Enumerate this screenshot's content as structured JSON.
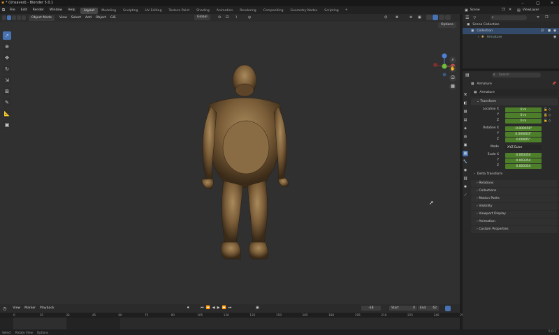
{
  "window": {
    "title": "* (Unsaved) - Blender 5.0.1"
  },
  "menu": [
    "File",
    "Edit",
    "Render",
    "Window",
    "Help"
  ],
  "workspaces": [
    {
      "label": "Layout",
      "active": true
    },
    {
      "label": "Modeling",
      "active": false
    },
    {
      "label": "Sculpting",
      "active": false
    },
    {
      "label": "UV Editing",
      "active": false
    },
    {
      "label": "Texture Paint",
      "active": false
    },
    {
      "label": "Shading",
      "active": false
    },
    {
      "label": "Animation",
      "active": false
    },
    {
      "label": "Rendering",
      "active": false
    },
    {
      "label": "Compositing",
      "active": false
    },
    {
      "label": "Geometry Nodes",
      "active": false
    },
    {
      "label": "Scripting",
      "active": false
    }
  ],
  "add_workspace": "+",
  "scene": "Scene",
  "view_layer": "ViewLayer",
  "viewport_header": {
    "mode": "Object Mode",
    "menus": [
      "View",
      "Select",
      "Add",
      "Object",
      "GIS"
    ],
    "orientation": "Global",
    "options": "Options"
  },
  "outliner": {
    "search_placeholder": "",
    "root": "Scene Collection",
    "collection": "Collection",
    "child": "Armature"
  },
  "properties": {
    "search_placeholder": "Search",
    "object_name": "Armature",
    "data_name": "Armature",
    "transform_title": "Transform",
    "location_label": "Location X",
    "location": [
      "0 m",
      "0 m",
      "0 m"
    ],
    "rotation_label": "Rotation X",
    "rotation": [
      "-0.000058°",
      "0.000003°",
      "0.00005°"
    ],
    "mode_label": "Mode",
    "mode_value": "XYZ Euler",
    "scale_label": "Scale X",
    "scale": [
      "0.003354",
      "0.003354",
      "0.003354"
    ],
    "axis_y": "Y",
    "axis_z": "Z",
    "delta": "Delta Transform",
    "panels": [
      "Relations",
      "Collections",
      "Motion Paths",
      "Visibility",
      "Viewport Display",
      "Animation",
      "Custom Properties"
    ]
  },
  "timeline": {
    "menus": [
      "View",
      "Marker",
      "Playback"
    ],
    "current_frame": "-18",
    "start_label": "Start",
    "start": "0",
    "end_label": "End",
    "end": "62",
    "ruler": [
      "0",
      "15",
      "30",
      "45",
      "60",
      "75",
      "90",
      "105",
      "120",
      "135",
      "150",
      "165",
      "180",
      "195",
      "210",
      "225",
      "240",
      "255"
    ]
  },
  "statusbar": {
    "left": [
      "Select",
      "Rotate View",
      "Options"
    ],
    "version": "5.0.1"
  },
  "colors": {
    "accent": "#4772b3",
    "field_green": "#4d7f2a",
    "viewport_bg": "#303030"
  }
}
